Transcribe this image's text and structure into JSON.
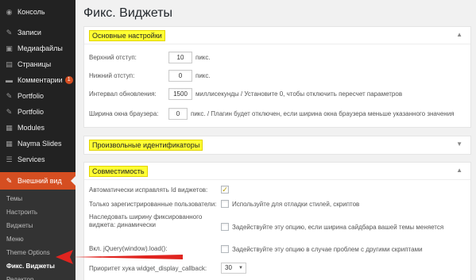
{
  "sidebar": {
    "items": [
      {
        "label": "Консоль",
        "icon": "dashboard-icon",
        "glyph": "◉"
      },
      {
        "label": "Записи",
        "icon": "pin-icon",
        "glyph": "✎"
      },
      {
        "label": "Медиафайлы",
        "icon": "media-icon",
        "glyph": "▣"
      },
      {
        "label": "Страницы",
        "icon": "page-icon",
        "glyph": "▤"
      },
      {
        "label": "Комментарии",
        "icon": "comment-icon",
        "glyph": "▬",
        "badge": "1"
      },
      {
        "label": "Portfolio",
        "icon": "pin-icon",
        "glyph": "✎"
      },
      {
        "label": "Portfolio",
        "icon": "pin-icon",
        "glyph": "✎"
      },
      {
        "label": "Modules",
        "icon": "modules-icon",
        "glyph": "▦"
      },
      {
        "label": "Nayma Slides",
        "icon": "slides-icon",
        "glyph": "▦"
      },
      {
        "label": "Services",
        "icon": "services-icon",
        "glyph": "☰"
      }
    ],
    "current": {
      "label": "Внешний вид",
      "icon": "appearance-icon",
      "glyph": "✎"
    },
    "submenu": [
      "Темы",
      "Настроить",
      "Виджеты",
      "Меню",
      "Theme Options",
      "Фикс. Виджеты",
      "Редактор"
    ],
    "active_sub": "Фикс. Виджеты"
  },
  "page_title": "Фикс. Виджеты",
  "box1": {
    "title": "Основные настройки",
    "rows": [
      {
        "label": "Верхний отступ:",
        "value": "10",
        "suffix": "пикс."
      },
      {
        "label": "Нижний отступ:",
        "value": "0",
        "suffix": "пикс."
      },
      {
        "label": "Интервал обновления:",
        "value": "1500",
        "suffix": "миллисекунды / Установите 0, чтобы отключить пересчет параметров"
      },
      {
        "label": "Ширина окна браузера:",
        "value": "0",
        "suffix": "пикс. / Плагин будет отключен, если ширина окна браузера меньше указанного значения"
      }
    ]
  },
  "box2": {
    "title": "Произвольные идентификаторы"
  },
  "box3": {
    "title": "Совместимость",
    "rows": [
      {
        "label": "Автоматически исправлять Id виджетов:",
        "checked": true,
        "text": ""
      },
      {
        "label": "Только зарегистрированные пользователи:",
        "checked": false,
        "text": "Используйте для отладки стилей, скриптов"
      },
      {
        "label": "Наследовать ширину фиксированного виджета: динамически",
        "checked": false,
        "text": "Задействуйте эту опцию, если ширина сайдбара вашей темы меняется"
      },
      {
        "label": "Вкл. jQuery(window).load():",
        "checked": false,
        "text": "Задействуйте эту опцию в случае проблем с другими скриптами"
      },
      {
        "label": "Приоритет хука widget_display_callback:",
        "select": "30"
      }
    ]
  },
  "toggle_glyph": "▲",
  "toggle_glyph_closed": "▼",
  "check_glyph": "✓",
  "select_arrow": "▼",
  "colors": {
    "accent": "#d54e21",
    "highlight": "#ffff33",
    "arrow": "#e0241f",
    "sidebar": "#222222"
  }
}
